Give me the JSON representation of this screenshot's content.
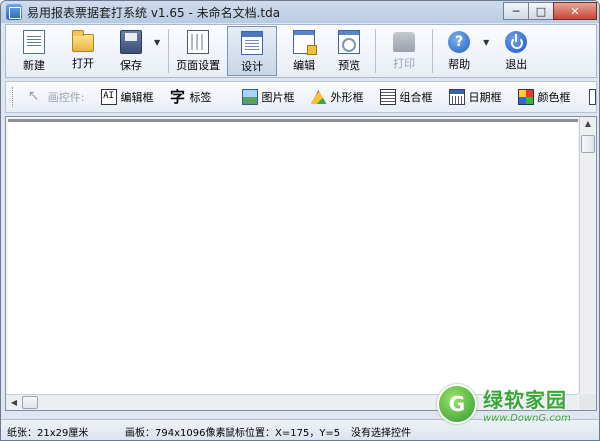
{
  "window": {
    "title": "易用报表票据套打系统 v1.65 - 未命名文档.tda",
    "minimize": "─",
    "maximize": "□",
    "close": "✕"
  },
  "toolbar": {
    "new": "新建",
    "open": "打开",
    "save": "保存",
    "page_setup": "页面设置",
    "design": "设计",
    "edit": "编辑",
    "preview": "预览",
    "print": "打印",
    "help": "帮助",
    "help_icon_glyph": "?",
    "exit": "退出",
    "dropdown_glyph": "▼"
  },
  "controls": {
    "pointer": "画控件:",
    "textbox": "编辑框",
    "textbox_glyph": "AI",
    "label": "标签",
    "label_glyph": "字",
    "image": "图片框",
    "shape": "外形框",
    "group": "组合框",
    "date": "日期框",
    "color": "颜色框"
  },
  "scroll": {
    "up": "▲",
    "left": "◀"
  },
  "status": {
    "paper": "纸张：21x29厘米",
    "canvas": "画板：794x1096像素",
    "mouse": "鼠标位置：X=175，Y=5",
    "selection": "没有选择控件"
  },
  "watermark": {
    "logo_glyph": "G",
    "name": "绿软家园",
    "url": "www.DownG.com"
  },
  "colors": {
    "titlebar": "#c3d3e8",
    "close_button": "#c8463a",
    "watermark_green": "#3aa63a"
  }
}
